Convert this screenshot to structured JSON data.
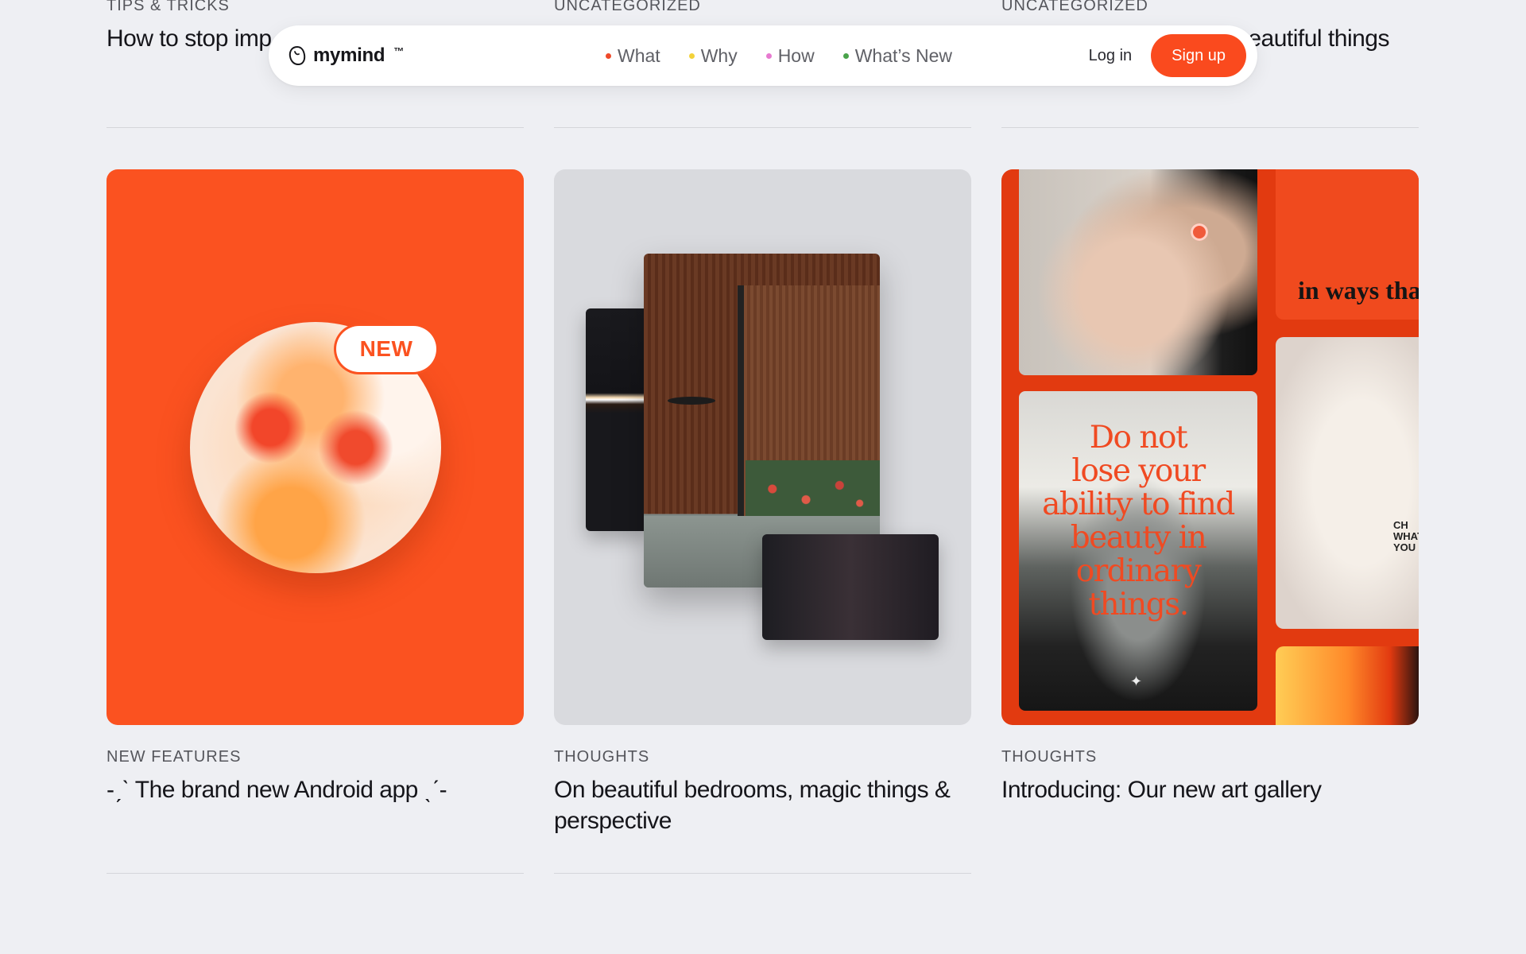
{
  "navbar": {
    "brand": "mymind",
    "trademark": "™",
    "links": [
      {
        "label": "What",
        "dot_color": "#ef4a2a"
      },
      {
        "label": "Why",
        "dot_color": "#f3d23a"
      },
      {
        "label": "How",
        "dot_color": "#e77ad0"
      },
      {
        "label": "What’s New",
        "dot_color": "#49a34a"
      }
    ],
    "login_label": "Log in",
    "signup_label": "Sign up",
    "accent": "#fa4a1e"
  },
  "top_cards": [
    {
      "category": "TIPS & TRICKS",
      "title": "How to stop imp"
    },
    {
      "category": "UNCATEGORIZED",
      "title": ""
    },
    {
      "category": "UNCATEGORIZED",
      "title": "eautiful things"
    }
  ],
  "cards": [
    {
      "category": "NEW FEATURES",
      "title": "-ˏˋ The brand new Android app ˎˊ-",
      "badge": "NEW"
    },
    {
      "category": "THOUGHTS",
      "title": "On beautiful bedrooms, magic things & perspective"
    },
    {
      "category": "THOUGHTS",
      "title": "Introducing: Our new art gallery",
      "poster_text": "Do not\nlose your\nability to find\nbeauty in\nordinary\nthings.",
      "side_text": "in ways that",
      "shirt_text": "CH\nWHAT\nYOU"
    }
  ]
}
